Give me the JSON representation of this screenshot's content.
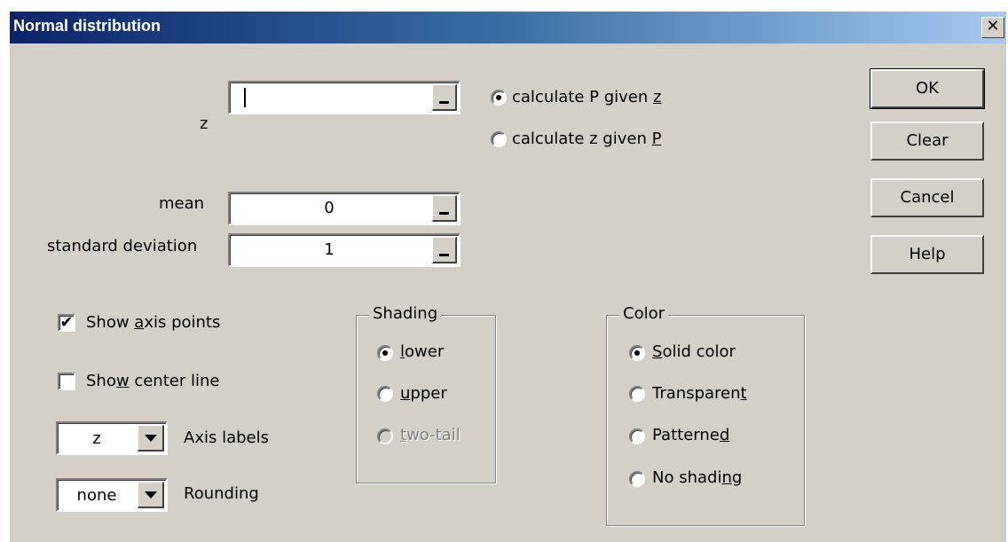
{
  "window": {
    "title": "Normal distribution",
    "close_glyph": "✕"
  },
  "z": {
    "label": "z",
    "value": ""
  },
  "mode": {
    "calc_p": {
      "text": "calculate P given ",
      "key": "z",
      "selected": true
    },
    "calc_z": {
      "text": "calculate z given ",
      "key": "P",
      "selected": false
    }
  },
  "mean": {
    "label": "mean",
    "value": "0"
  },
  "sd": {
    "label": "standard deviation",
    "value": "1"
  },
  "buttons": {
    "ok": "OK",
    "clear": "Clear",
    "cancel": "Cancel",
    "help": "Help"
  },
  "options": {
    "show_axis_points": {
      "pre": "Show ",
      "key": "a",
      "post": "xis points",
      "checked": true
    },
    "show_center_line": {
      "pre": "Sho",
      "key": "w",
      "post": " center line",
      "checked": false
    }
  },
  "axis_labels": {
    "value": "z",
    "label": "Axis labels"
  },
  "rounding": {
    "value": "none",
    "label": "Rounding"
  },
  "shading": {
    "title": "Shading",
    "lower": {
      "key": "l",
      "rest": "ower",
      "selected": true
    },
    "upper": {
      "key": "u",
      "rest": "pper",
      "selected": false
    },
    "two_tail": {
      "key": "t",
      "rest": "wo-tail",
      "selected": false,
      "disabled": true
    }
  },
  "color": {
    "title": "Color",
    "solid": {
      "key": "S",
      "rest": "olid color",
      "selected": true
    },
    "transparent": {
      "pre": "Transparen",
      "key": "t",
      "selected": false
    },
    "patterned": {
      "pre": "Patterne",
      "key": "d",
      "selected": false
    },
    "no_shading": {
      "pre": "No shadi",
      "key": "n",
      "post": "g",
      "selected": false
    }
  },
  "icons": {
    "check_mark": "✔"
  }
}
